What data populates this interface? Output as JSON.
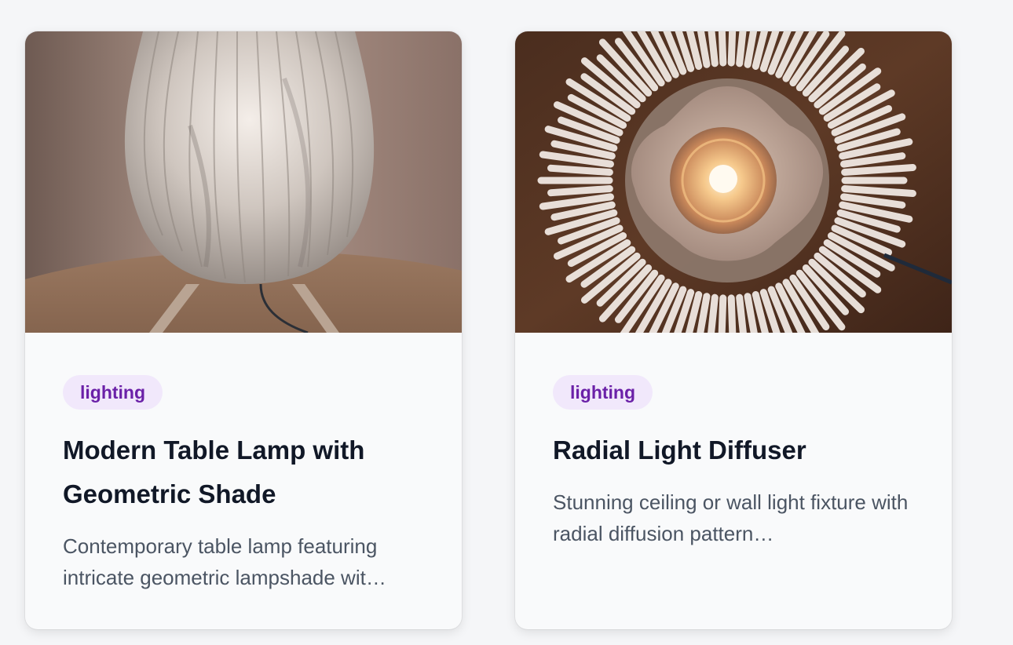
{
  "cards": [
    {
      "image_alt": "table-lamp-photo",
      "tag": "lighting",
      "title": "Modern Table Lamp with Geometric Shade",
      "description": "Contemporary table lamp featuring intricate geometric lampshade wit…"
    },
    {
      "image_alt": "radial-diffuser-photo",
      "tag": "lighting",
      "title": "Radial Light Diffuser",
      "description": "Stunning ceiling or wall light fixture with radial diffusion pattern…"
    }
  ],
  "colors": {
    "page_bg": "#f5f6f8",
    "card_bg": "#f9fafb",
    "tag_bg": "#f1e8fb",
    "tag_text": "#6b21a8",
    "title_text": "#111827",
    "desc_text": "#4b5563"
  }
}
